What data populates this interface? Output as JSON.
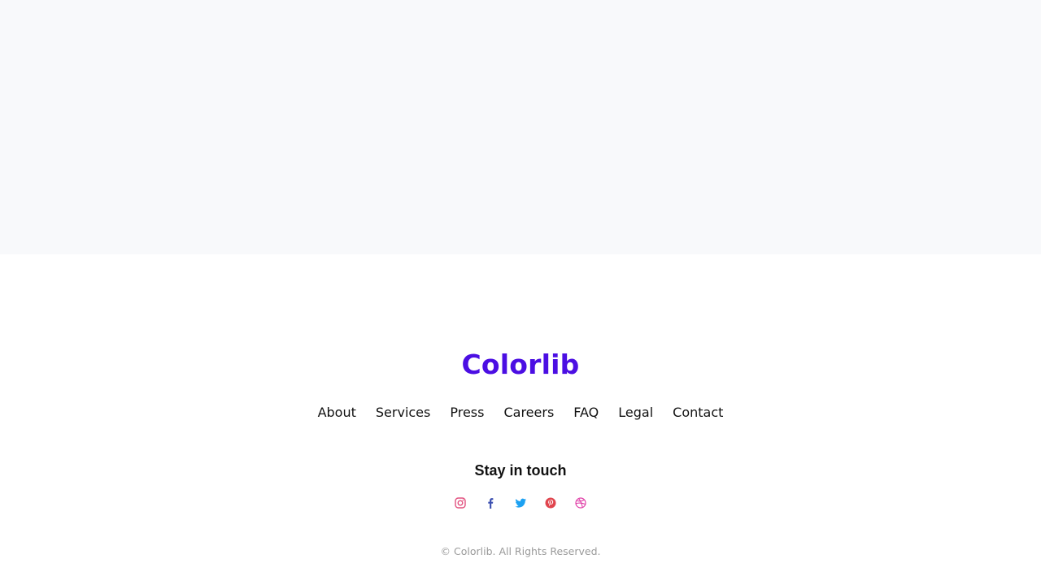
{
  "footer": {
    "brand": "Colorlib",
    "nav": [
      {
        "label": "About"
      },
      {
        "label": "Services"
      },
      {
        "label": "Press"
      },
      {
        "label": "Careers"
      },
      {
        "label": "FAQ"
      },
      {
        "label": "Legal"
      },
      {
        "label": "Contact"
      }
    ],
    "stay_in_touch": "Stay in touch",
    "social": [
      {
        "icon": "instagram-icon",
        "color": "#e2517f"
      },
      {
        "icon": "facebook-icon",
        "color": "#3b4fb0"
      },
      {
        "icon": "twitter-icon",
        "color": "#1da1f2"
      },
      {
        "icon": "pinterest-icon",
        "color": "#e0454e"
      },
      {
        "icon": "dribbble-icon",
        "color": "#e040a8"
      }
    ],
    "copyright": "© Colorlib. All Rights Reserved."
  },
  "colors": {
    "brand": "#4b0ee3",
    "top_band": "#f8f9fb",
    "text": "#111111",
    "muted": "#9a9a9a"
  }
}
